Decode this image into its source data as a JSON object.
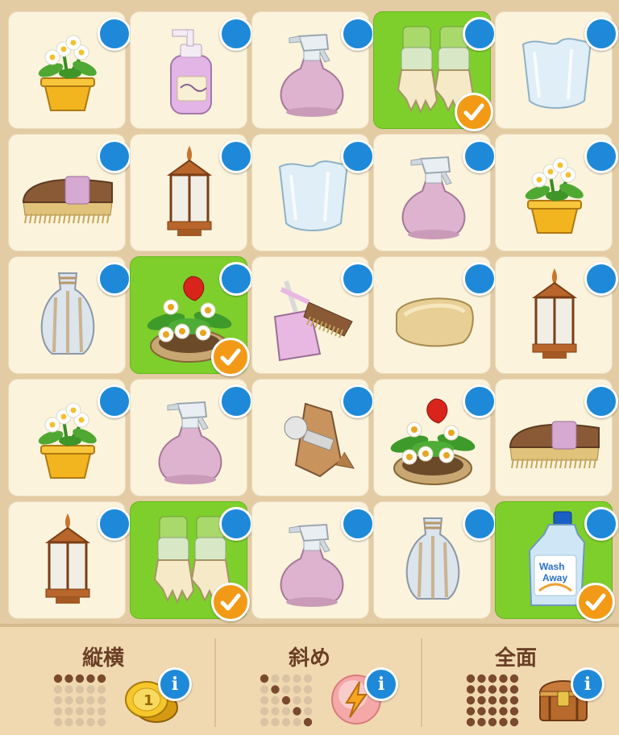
{
  "grid": {
    "rows": 5,
    "cols": 5,
    "cells": [
      {
        "item": "potted-white-flowers",
        "bg": "cream",
        "checked": false
      },
      {
        "item": "soap-pump-bottle",
        "bg": "cream",
        "checked": false
      },
      {
        "item": "spray-bottle",
        "bg": "cream",
        "checked": false
      },
      {
        "item": "garden-gloves",
        "bg": "green",
        "checked": true
      },
      {
        "item": "glass-vase",
        "bg": "cream",
        "checked": false
      },
      {
        "item": "scrub-brush",
        "bg": "cream",
        "checked": false
      },
      {
        "item": "lantern",
        "bg": "cream",
        "checked": false
      },
      {
        "item": "glass-vase",
        "bg": "cream",
        "checked": false
      },
      {
        "item": "spray-bottle",
        "bg": "cream",
        "checked": false
      },
      {
        "item": "potted-white-flowers",
        "bg": "cream",
        "checked": false
      },
      {
        "item": "ceramic-vase",
        "bg": "cream",
        "checked": false
      },
      {
        "item": "flower-bed-planter",
        "bg": "green",
        "checked": true
      },
      {
        "item": "dustpan-and-brush",
        "bg": "cream",
        "checked": false
      },
      {
        "item": "soap-bar",
        "bg": "cream",
        "checked": false
      },
      {
        "item": "lantern",
        "bg": "cream",
        "checked": false
      },
      {
        "item": "potted-white-flowers",
        "bg": "cream",
        "checked": false
      },
      {
        "item": "spray-bottle",
        "bg": "cream",
        "checked": false
      },
      {
        "item": "plunger",
        "bg": "cream",
        "checked": false
      },
      {
        "item": "flower-bed-planter",
        "bg": "cream",
        "checked": false
      },
      {
        "item": "scrub-brush",
        "bg": "cream",
        "checked": false
      },
      {
        "item": "lantern",
        "bg": "cream",
        "checked": false
      },
      {
        "item": "garden-gloves",
        "bg": "green",
        "checked": true
      },
      {
        "item": "spray-bottle",
        "bg": "cream",
        "checked": false
      },
      {
        "item": "ceramic-vase",
        "bg": "cream",
        "checked": false
      },
      {
        "item": "detergent-bottle",
        "bg": "green",
        "checked": true,
        "label_line1": "Wash",
        "label_line2": "Away"
      }
    ]
  },
  "icons": {
    "info": "info-icon",
    "check": "checkmark-icon"
  },
  "info_letter": "i",
  "bottom_panels": [
    {
      "id": "rows-columns",
      "label": "縦横",
      "pattern": "rows-columns",
      "reward": "gold-coins",
      "reward_amount": "1"
    },
    {
      "id": "diagonal",
      "label": "斜め",
      "pattern": "diagonal",
      "reward": "energy-bolt"
    },
    {
      "id": "full",
      "label": "全面",
      "pattern": "full",
      "reward": "treasure-chest"
    }
  ],
  "colors": {
    "cell_green": "#7fcf2c",
    "cell_cream": "#fbf3dc",
    "info_blue": "#1e89d8",
    "check_orange": "#f29a16",
    "label_brown": "#6a3f26",
    "dot_dark": "#7a4a2e",
    "dot_light": "#d9c3a3"
  }
}
